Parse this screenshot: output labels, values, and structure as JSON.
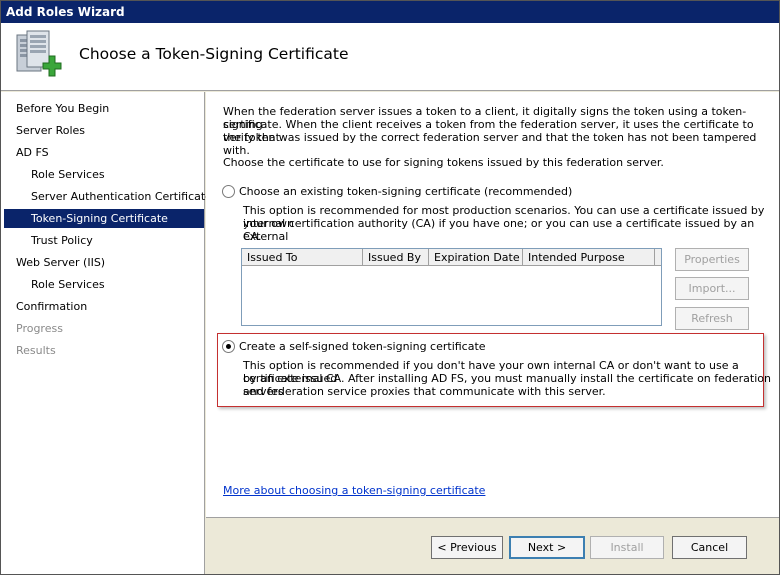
{
  "window": {
    "title": "Add Roles Wizard"
  },
  "header": {
    "title": "Choose a Token-Signing Certificate",
    "icon": "server-add-icon"
  },
  "sidebar": {
    "items": [
      {
        "label": "Before You Begin",
        "level": 0,
        "state": "normal"
      },
      {
        "label": "Server Roles",
        "level": 0,
        "state": "normal"
      },
      {
        "label": "AD FS",
        "level": 0,
        "state": "normal"
      },
      {
        "label": "Role Services",
        "level": 1,
        "state": "normal"
      },
      {
        "label": "Server Authentication Certificate",
        "level": 1,
        "state": "normal"
      },
      {
        "label": "Token-Signing Certificate",
        "level": 1,
        "state": "active"
      },
      {
        "label": "Trust Policy",
        "level": 1,
        "state": "normal"
      },
      {
        "label": "Web Server (IIS)",
        "level": 0,
        "state": "normal"
      },
      {
        "label": "Role Services",
        "level": 1,
        "state": "normal"
      },
      {
        "label": "Confirmation",
        "level": 0,
        "state": "normal"
      },
      {
        "label": "Progress",
        "level": 0,
        "state": "disabled"
      },
      {
        "label": "Results",
        "level": 0,
        "state": "disabled"
      }
    ]
  },
  "content": {
    "intro1_l1": "When the federation server issues a token to a client, it digitally signs the token using a token-signing",
    "intro1_l2": "certificate. When the client receives a token from the federation server, it uses the certificate to verify that",
    "intro1_l3": "the token was issued by the correct federation server and that the token has not been tampered with.",
    "intro2": "Choose the certificate to use for signing tokens issued by this federation server.",
    "option_existing": {
      "label": "Choose an existing token-signing certificate (recommended)",
      "desc_l1": "This option is recommended for most production scenarios. You can use a certificate issued by your own",
      "desc_l2": "internal certification authority (CA) if you have one; or you can use a certificate issued by an external",
      "desc_l3": "CA.",
      "checked": false
    },
    "cert_table": {
      "columns": [
        "Issued To",
        "Issued By",
        "Expiration Date",
        "Intended Purpose"
      ],
      "rows": []
    },
    "side_buttons": {
      "properties": "Properties",
      "import": "Import...",
      "refresh": "Refresh"
    },
    "option_selfsigned": {
      "label": "Create a self-signed token-signing certificate",
      "desc_l1": "This option is recommended if you don't have your own internal CA or don't want to use a certificate issued",
      "desc_l2": "by an external CA. After installing AD FS, you must manually install the certificate on federation servers",
      "desc_l3": "and federation service proxies that communicate with this server.",
      "checked": true
    },
    "more_link": "More about choosing a token-signing certificate"
  },
  "footer": {
    "previous": "< Previous",
    "next": "Next >",
    "install": "Install",
    "cancel": "Cancel"
  },
  "colors": {
    "title_bar": "#0a246a",
    "highlight": "#0a246a",
    "link": "#0033cc",
    "emphasis_border": "#c43030"
  }
}
